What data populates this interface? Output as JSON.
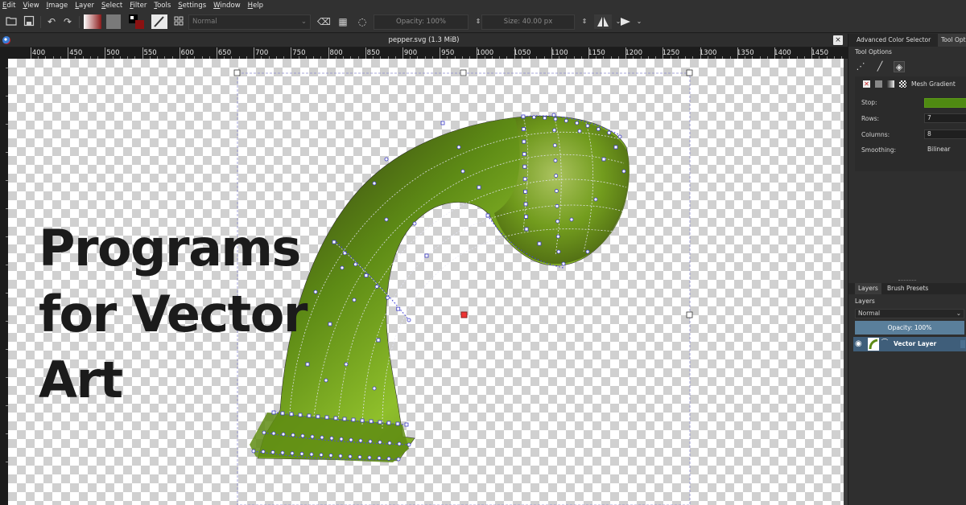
{
  "menu": [
    "Edit",
    "View",
    "Image",
    "Layer",
    "Select",
    "Filter",
    "Tools",
    "Settings",
    "Window",
    "Help"
  ],
  "toolbar": {
    "blend_mode": "Normal",
    "opacity": "Opacity: 100%",
    "size": "Size: 40.00 px"
  },
  "document": {
    "tab_title": "pepper.svg (1.3 MiB)",
    "close_glyph": "×"
  },
  "ruler": {
    "ticks": [
      "400",
      "450",
      "500",
      "550",
      "600",
      "650",
      "700",
      "750",
      "800",
      "850",
      "900",
      "950",
      "1000",
      "1050",
      "1100",
      "1150",
      "1200",
      "1250",
      "1300",
      "1350",
      "1400",
      "1450"
    ]
  },
  "overlay": {
    "line1": "Programs",
    "line2": "for Vector",
    "line3": "Art"
  },
  "docker": {
    "tab1": "Advanced Color Selector",
    "tab2": "Tool Opti",
    "section_title": "Tool Options",
    "fill_type": "Mesh Gradient",
    "stop_label": "Stop:",
    "rows_label": "Rows:",
    "rows_value": "7",
    "columns_label": "Columns:",
    "columns_value": "8",
    "smoothing_label": "Smoothing:",
    "smoothing_value": "Bilinear",
    "stop_color": "#4f8a12"
  },
  "layers": {
    "tab1": "Layers",
    "tab2": "Brush Presets",
    "title": "Layers",
    "blend_mode": "Normal",
    "opacity": "Opacity: 100%",
    "layer_name": "Vector Layer"
  }
}
